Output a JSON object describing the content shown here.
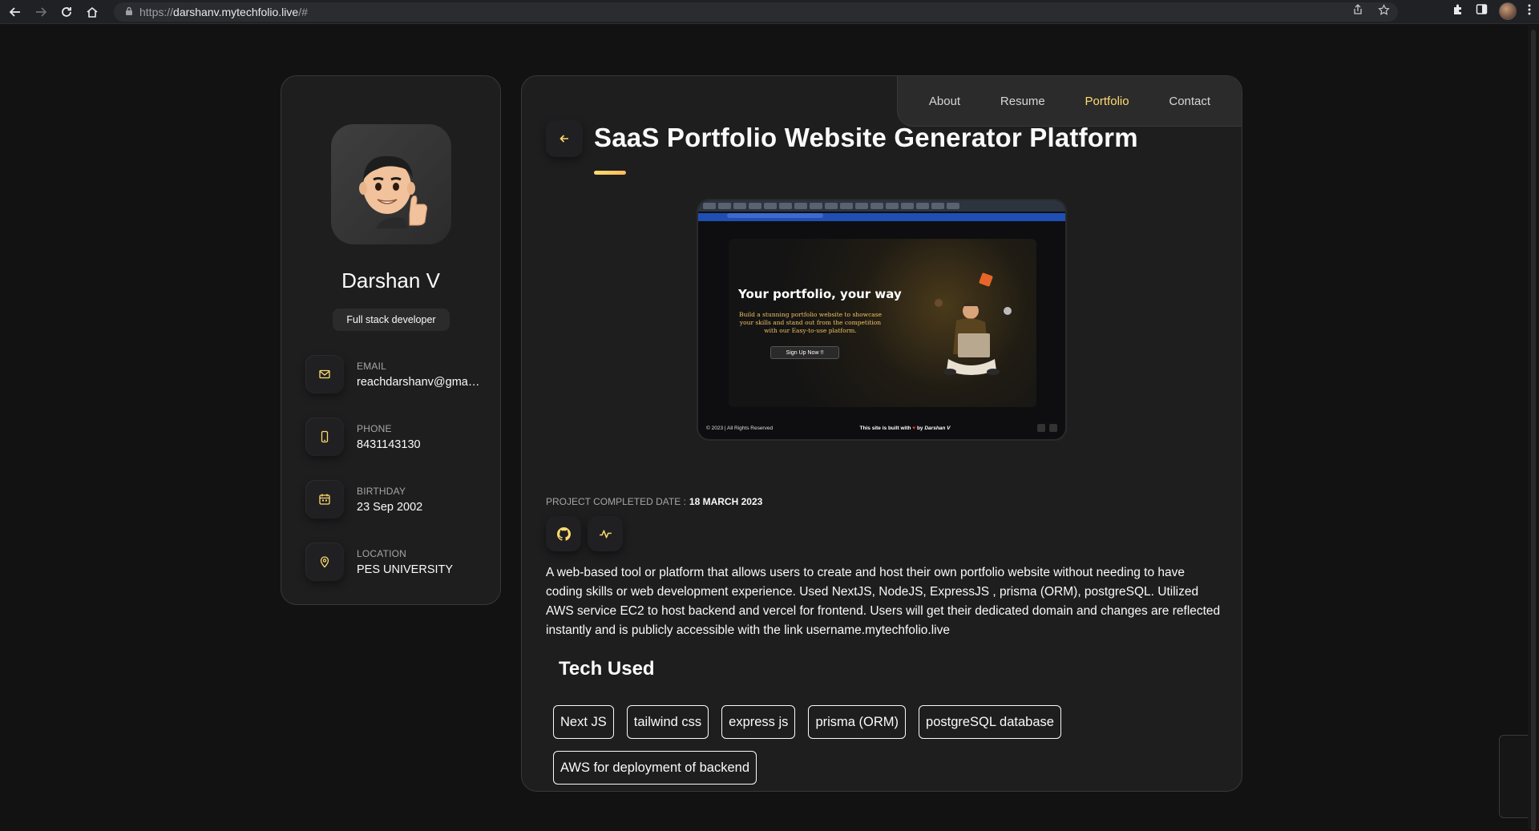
{
  "browser": {
    "url_scheme": "https://",
    "url_host": "darshanv.mytechfolio.live",
    "url_path": "/#"
  },
  "profile": {
    "name": "Darshan V",
    "role": "Full stack developer",
    "contacts": [
      {
        "label": "EMAIL",
        "value": "reachdarshanv@gma…",
        "icon": "mail-icon"
      },
      {
        "label": "PHONE",
        "value": "8431143130",
        "icon": "phone-icon"
      },
      {
        "label": "BIRTHDAY",
        "value": "23 Sep 2002",
        "icon": "calendar-icon"
      },
      {
        "label": "LOCATION",
        "value": "PES UNIVERSITY",
        "icon": "location-pin-icon"
      }
    ]
  },
  "navbar": {
    "items": [
      {
        "label": "About",
        "active": false
      },
      {
        "label": "Resume",
        "active": false
      },
      {
        "label": "Portfolio",
        "active": true
      },
      {
        "label": "Contact",
        "active": false
      }
    ]
  },
  "project": {
    "title": "SaaS Portfolio Website Generator Platform",
    "completed_label": "PROJECT COMPLETED DATE :",
    "completed_date": "18 MARCH 2023",
    "description": "A web-based tool or platform that allows users to create and host their own portfolio website without needing to have coding skills or web development experience. Used NextJS, NodeJS, ExpressJS , prisma (ORM), postgreSQL. Utilized AWS service EC2 to host backend and vercel for frontend. Users will get their dedicated domain and changes are reflected instantly and is publicly accessible with the link username.mytechfolio.live",
    "tech_heading": "Tech Used",
    "tech": [
      "Next JS",
      "tailwind css",
      "express js",
      "prisma (ORM)",
      "postgreSQL database",
      "AWS for deployment of backend"
    ],
    "preview": {
      "headline": "Your portfolio, your way",
      "subtext": "Build a stunning portfolio website to showcase your skills and stand out from the competition with our Easy-to-use platform.",
      "cta": "Sign Up Now !!",
      "footer_left": "© 2023 | All Rights Reserved",
      "footer_center_prefix": "This site is built with",
      "footer_center_suffix": "by",
      "footer_center_author": "Darshan V"
    }
  },
  "colors": {
    "accent": "#ffdb70",
    "background": "#121212",
    "card": "#1e1e1f"
  }
}
